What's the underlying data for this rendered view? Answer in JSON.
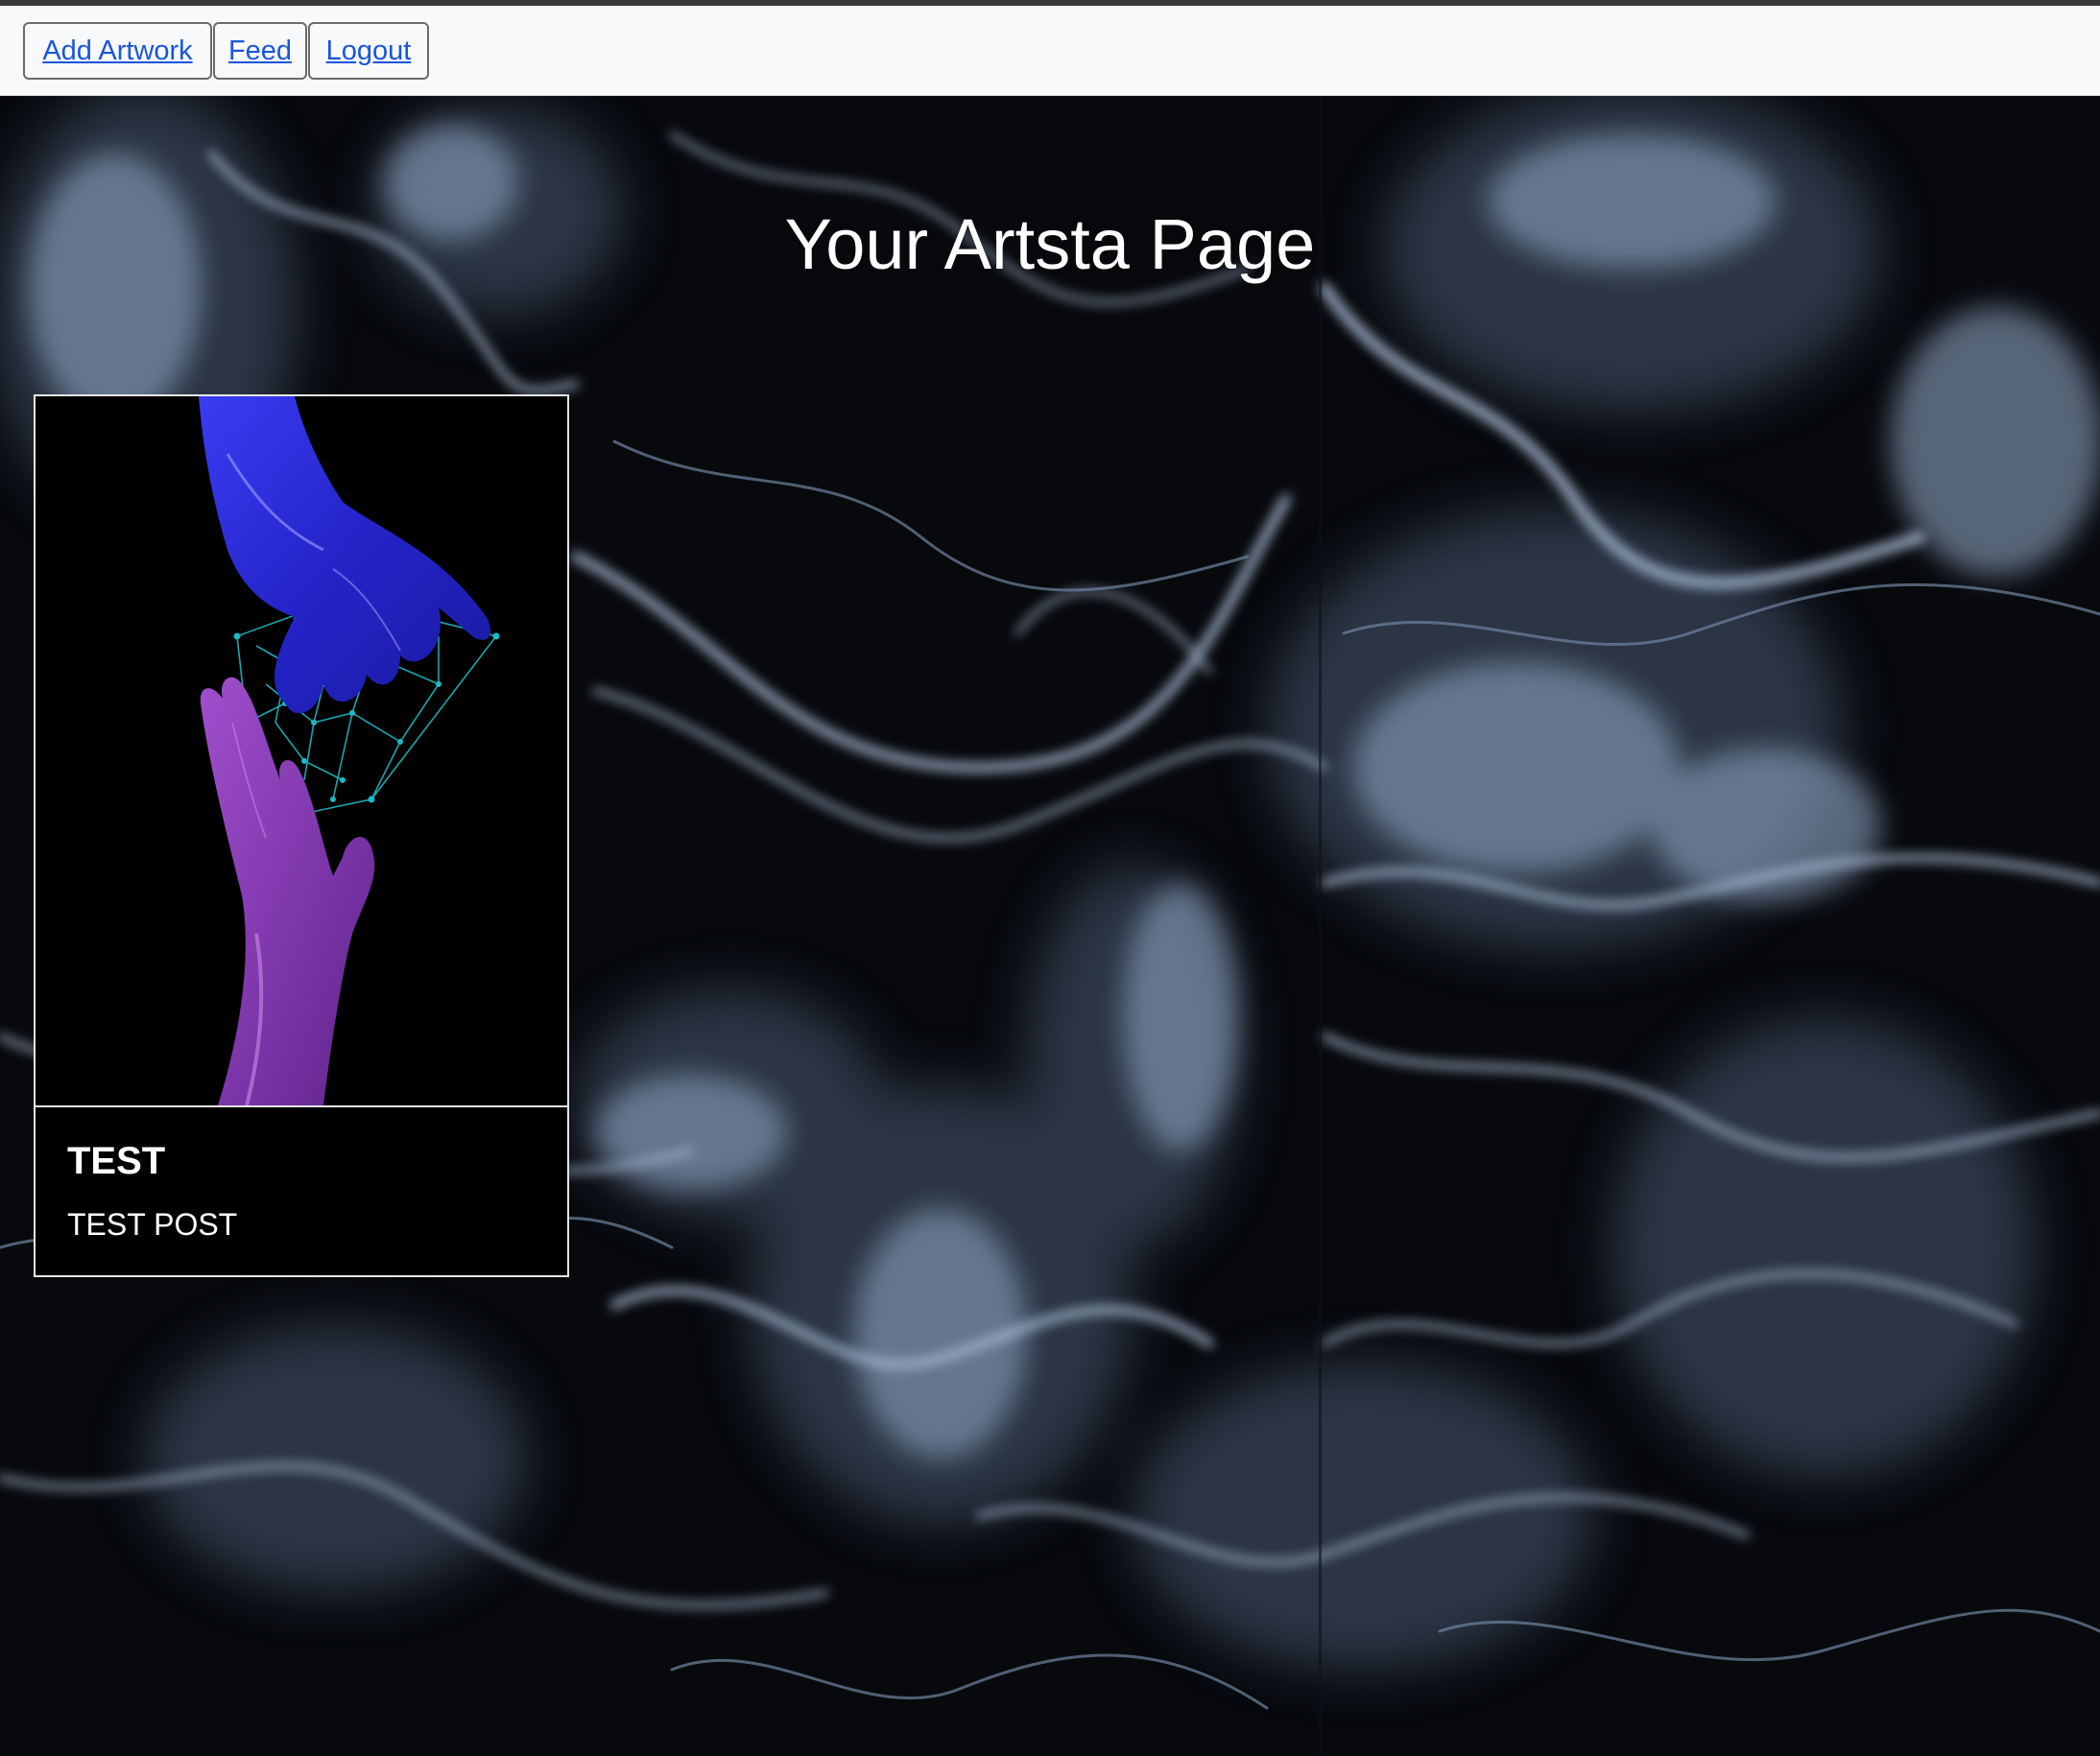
{
  "navbar": {
    "add_artwork": "Add Artwork",
    "feed": "Feed",
    "logout": "Logout"
  },
  "page": {
    "title": "Your Artsta Page"
  },
  "posts": [
    {
      "title": "TEST",
      "description": "TEST POST"
    }
  ],
  "colors": {
    "navbar_bg": "#f8f9fa",
    "link": "#1a56db",
    "background_dark": "#07090d",
    "marble_light": "#9fb3cf",
    "card_bg": "#000000",
    "upper_hand": "#2a2be0",
    "lower_hand": "#8a3fb0",
    "circuit": "#1fb8c4"
  }
}
